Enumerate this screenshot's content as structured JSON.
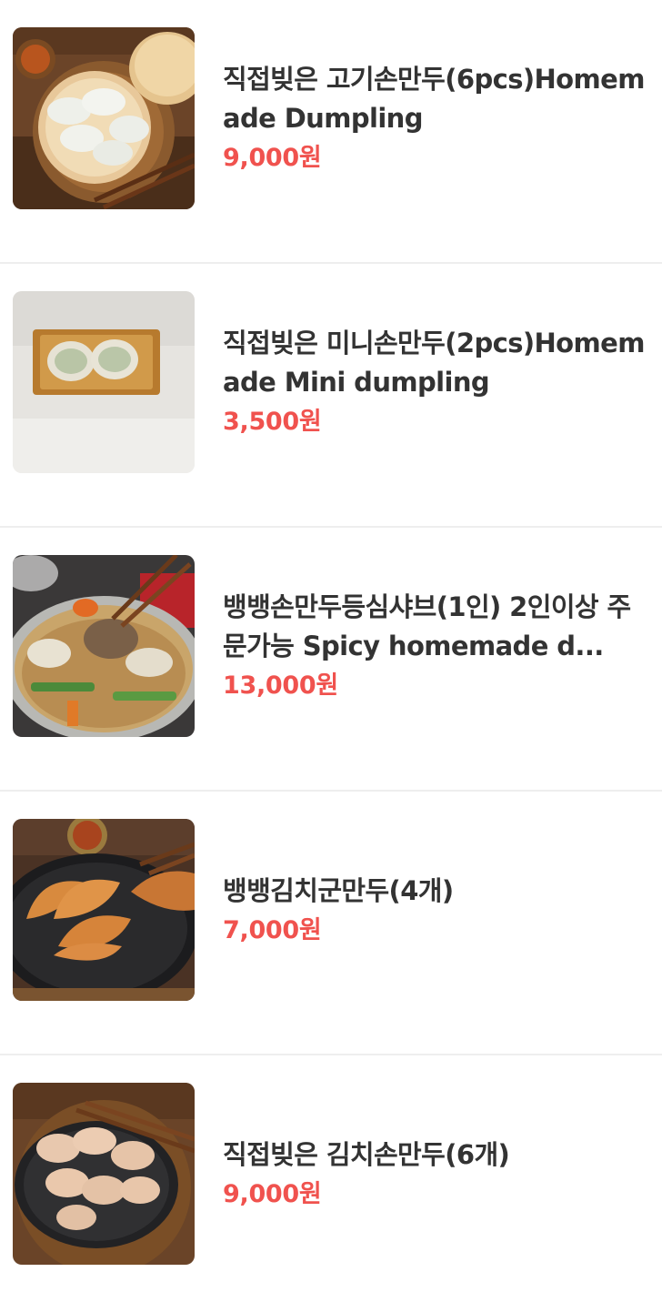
{
  "menu": {
    "items": [
      {
        "name": "직접빚은 고기손만두(6pcs)Homemade Dumpling",
        "price": "9,000원",
        "image_icon": "steamed-dumplings-photo"
      },
      {
        "name": "직접빚은 미니손만두(2pcs)Homemade Mini dumpling",
        "price": "3,500원",
        "image_icon": "mini-dumplings-photo"
      },
      {
        "name": "뱅뱅손만두등심샤브(1인) 2인이상 주문가능 Spicy homemade d...",
        "price": "13,000원",
        "image_icon": "shabu-hotpot-photo"
      },
      {
        "name": "뱅뱅김치군만두(4개)",
        "price": "7,000원",
        "image_icon": "fried-dumplings-photo"
      },
      {
        "name": "직접빚은 김치손만두(6개)",
        "price": "9,000원",
        "image_icon": "kimchi-dumplings-photo"
      }
    ]
  },
  "colors": {
    "price": "#f0524e",
    "name": "#333333",
    "divider": "#eeeeee"
  }
}
